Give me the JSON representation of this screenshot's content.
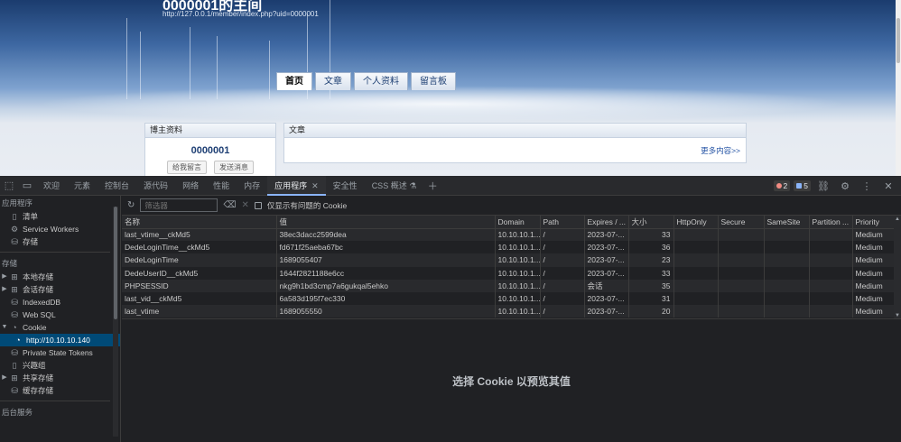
{
  "webpage": {
    "title": "0000001的主间",
    "url": "http://127.0.0.1/member/index.php?uid=0000001",
    "nav": [
      "首页",
      "文章",
      "个人资料",
      "留言板"
    ],
    "owner_panel": {
      "title": "博主资料",
      "user_id": "0000001",
      "buttons": [
        "给我留言",
        "发送消息"
      ]
    },
    "articles_panel": {
      "title": "文章",
      "more_link": "更多内容>>"
    }
  },
  "devtools": {
    "tabs": [
      "欢迎",
      "元素",
      "控制台",
      "源代码",
      "网络",
      "性能",
      "内存",
      "应用程序",
      "安全性",
      "CSS 概述"
    ],
    "active_tab": "应用程序",
    "error_count": "2",
    "info_count": "5",
    "sidebar": {
      "app_section": "应用程序",
      "app_items": [
        "清单",
        "Service Workers",
        "存储"
      ],
      "storage_section": "存储",
      "storage_items": [
        "本地存储",
        "会话存储",
        "IndexedDB",
        "Web SQL",
        "Cookie"
      ],
      "cookie_child": "http://10.10.10.140",
      "storage_items_2": [
        "Private State Tokens",
        "兴趣组",
        "共享存储",
        "缓存存储"
      ],
      "bg_section": "后台服务"
    },
    "filter": {
      "placeholder": "筛选器",
      "checkbox_label": "仅显示有问题的 Cookie"
    },
    "columns": [
      "名称",
      "值",
      "Domain",
      "Path",
      "Expires / ...",
      "大小",
      "HttpOnly",
      "Secure",
      "SameSite",
      "Partition ...",
      "Priority"
    ],
    "cookies": [
      {
        "name": "last_vtime__ckMd5",
        "value": "38ec3dacc2599dea",
        "domain": "10.10.10.1...",
        "path": "/",
        "expires": "2023-07-...",
        "size": "33",
        "priority": "Medium"
      },
      {
        "name": "DedeLoginTime__ckMd5",
        "value": "fd671f25aeba67bc",
        "domain": "10.10.10.1...",
        "path": "/",
        "expires": "2023-07-...",
        "size": "36",
        "priority": "Medium"
      },
      {
        "name": "DedeLoginTime",
        "value": "1689055407",
        "domain": "10.10.10.1...",
        "path": "/",
        "expires": "2023-07-...",
        "size": "23",
        "priority": "Medium"
      },
      {
        "name": "DedeUserID__ckMd5",
        "value": "1644f2821188e6cc",
        "domain": "10.10.10.1...",
        "path": "/",
        "expires": "2023-07-...",
        "size": "33",
        "priority": "Medium"
      },
      {
        "name": "PHPSESSID",
        "value": "nkg9h1bd3cmp7a6gukqal5ehko",
        "domain": "10.10.10.1...",
        "path": "/",
        "expires": "会话",
        "size": "35",
        "priority": "Medium"
      },
      {
        "name": "last_vid__ckMd5",
        "value": "6a583d195f7ec330",
        "domain": "10.10.10.1...",
        "path": "/",
        "expires": "2023-07-...",
        "size": "31",
        "priority": "Medium"
      },
      {
        "name": "last_vtime",
        "value": "1689055550",
        "domain": "10.10.10.1...",
        "path": "/",
        "expires": "2023-07-...",
        "size": "20",
        "priority": "Medium"
      }
    ],
    "preview_text": "选择 Cookie 以预览其值"
  }
}
